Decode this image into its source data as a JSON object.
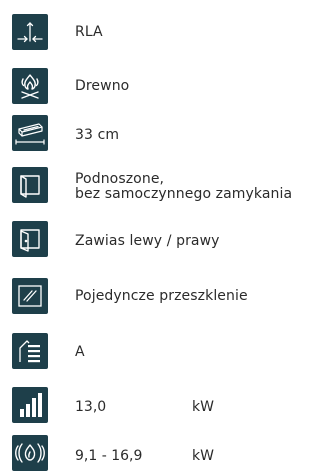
{
  "features": {
    "items": [
      {
        "icon": "air-supply-arrows-icon",
        "label": "RLA"
      },
      {
        "icon": "wood-flame-icon",
        "label": "Drewno"
      },
      {
        "icon": "log-length-icon",
        "label": "33 cm"
      },
      {
        "icon": "lift-door-icon",
        "label_line1": "Podnoszone,",
        "label_line2": "bez samoczynnego zamykania"
      },
      {
        "icon": "hinge-door-icon",
        "label": "Zawias lewy / prawy"
      },
      {
        "icon": "single-glazing-icon",
        "label": "Pojedyncze przeszklenie"
      },
      {
        "icon": "energy-class-icon",
        "label": "A"
      },
      {
        "icon": "power-bars-icon",
        "value": "13,0",
        "unit": "kW"
      },
      {
        "icon": "heat-range-icon",
        "value": "9,1 - 16,9",
        "unit": "kW"
      }
    ]
  },
  "colors": {
    "icon_bg": "#1e3f4a",
    "icon_fg": "#ffffff",
    "text": "#2b2b2b"
  }
}
